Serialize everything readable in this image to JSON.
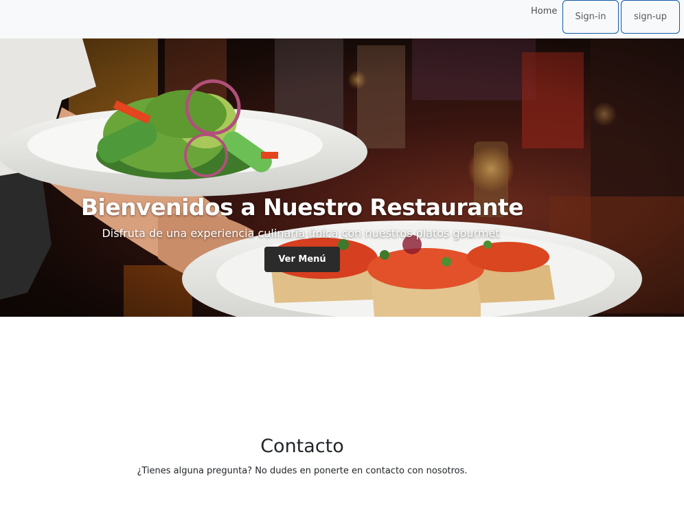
{
  "navbar": {
    "home_label": "Home",
    "signin_label": "Sign-in",
    "signup_label": "sign-up",
    "border_color": "#0d5aa7"
  },
  "hero": {
    "title": "Bienvenidos a Nuestro Restaurante",
    "subtitle": "Disfruta de una experiencia culinaria única con nuestros platos gourmet",
    "button_label": "Ver Menú"
  },
  "contact": {
    "title": "Contacto",
    "text": "¿Tienes alguna pregunta? No dudes en ponerte en contacto con nosotros."
  }
}
